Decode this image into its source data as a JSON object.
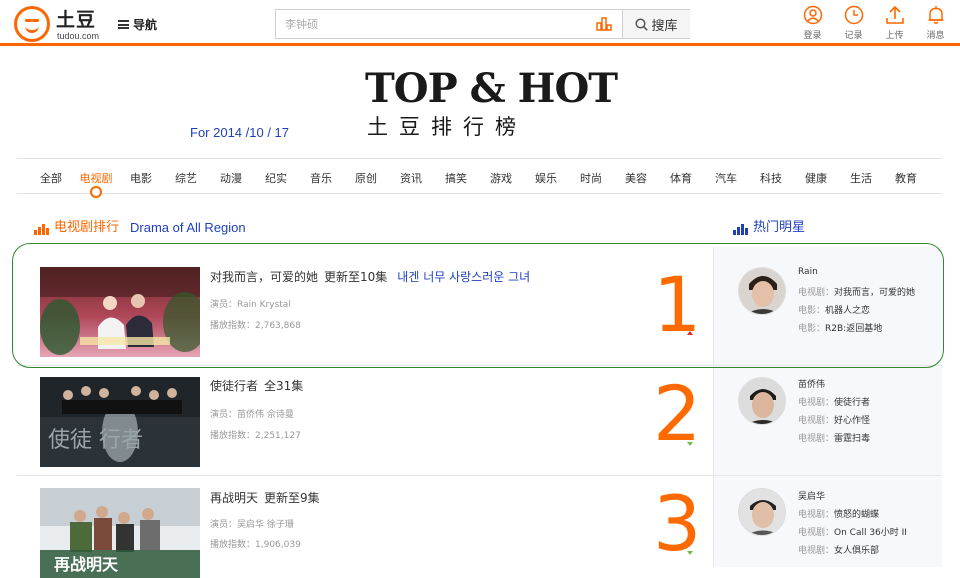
{
  "header": {
    "logo_text": "土豆",
    "logo_sub": "tudou.com",
    "nav_label": "导航",
    "search_placeholder": "李钟硕",
    "search_button": "搜库",
    "actions": [
      {
        "label": "登录",
        "icon": "user-icon"
      },
      {
        "label": "记录",
        "icon": "clock-icon"
      },
      {
        "label": "上传",
        "icon": "upload-icon"
      },
      {
        "label": "消息",
        "icon": "bell-icon"
      }
    ]
  },
  "banner": {
    "title": "TOP & HOT",
    "subtitle": "土豆排行榜",
    "date": "For 2014 /10 / 17"
  },
  "categories": [
    "全部",
    "电视剧",
    "电影",
    "综艺",
    "动漫",
    "纪实",
    "音乐",
    "原创",
    "资讯",
    "搞笑",
    "游戏",
    "娱乐",
    "时尚",
    "美容",
    "体育",
    "汽车",
    "科技",
    "健康",
    "生活",
    "教育"
  ],
  "active_category": "电视剧",
  "section": {
    "title_cn": "电视剧排行",
    "title_en": "Drama of All Region",
    "stars_title": "热门明星"
  },
  "rankings": [
    {
      "rank": "1",
      "trend": "up",
      "title": "对我而言，可爱的她",
      "status": "更新至10集",
      "korean": "내겐 너무 사랑스러운 그녀",
      "actors_label": "演员：",
      "actors": "Rain  Krystal",
      "plays_label": "播放指数：",
      "plays": "2,763,868",
      "star": {
        "name": "Rain",
        "works": [
          {
            "label": "电视剧：",
            "value": "对我而言，可爱的她"
          },
          {
            "label": "电影：",
            "value": "机器人之恋"
          },
          {
            "label": "电影：",
            "value": "R2B:返回基地"
          }
        ]
      }
    },
    {
      "rank": "2",
      "trend": "down",
      "title": "使徒行者",
      "status": "全31集",
      "korean": "",
      "actors_label": "演员：",
      "actors": "苗侨伟  佘诗曼",
      "plays_label": "播放指数：",
      "plays": "2,251,127",
      "star": {
        "name": "苗侨伟",
        "works": [
          {
            "label": "电视剧：",
            "value": "使徒行者"
          },
          {
            "label": "电视剧：",
            "value": "好心作怪"
          },
          {
            "label": "电视剧：",
            "value": "雷霆扫毒"
          }
        ]
      }
    },
    {
      "rank": "3",
      "trend": "down",
      "title": "再战明天",
      "status": "更新至9集",
      "korean": "",
      "actors_label": "演员：",
      "actors": "吴启华  徐子珊",
      "plays_label": "播放指数：",
      "plays": "1,906,039",
      "star": {
        "name": "吴启华",
        "works": [
          {
            "label": "电视剧：",
            "value": "愤怒的蝴蝶"
          },
          {
            "label": "电视剧：",
            "value": "On Call 36小时 II"
          },
          {
            "label": "电视剧：",
            "value": "女人俱乐部"
          }
        ]
      }
    }
  ],
  "thumb_texts": {
    "ep2": "使徒    行者",
    "ep3": "再战明天"
  },
  "colors": {
    "accent": "#ff6600",
    "link_blue": "#1f3fbf",
    "rank_orange": "#ff6a00",
    "highlight_green": "#2f8a2f"
  }
}
